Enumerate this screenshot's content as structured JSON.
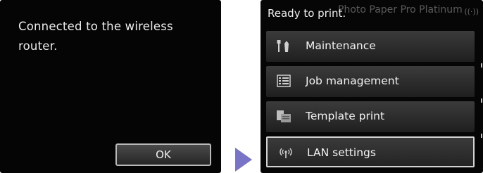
{
  "left_screen": {
    "message": "Connected to the wireless router.",
    "ok_label": "OK"
  },
  "right_screen": {
    "status": "Ready to print.",
    "media": "Photo Paper Pro Platinum",
    "menu": [
      {
        "label": "Maintenance",
        "icon": "maintenance-icon"
      },
      {
        "label": "Job management",
        "icon": "job-list-icon"
      },
      {
        "label": "Template print",
        "icon": "template-print-icon"
      },
      {
        "label": "LAN settings",
        "icon": "wireless-signal-icon",
        "selected": true
      }
    ]
  },
  "colors": {
    "arrow": "#7a74c8",
    "screen_bg": "#050505"
  }
}
